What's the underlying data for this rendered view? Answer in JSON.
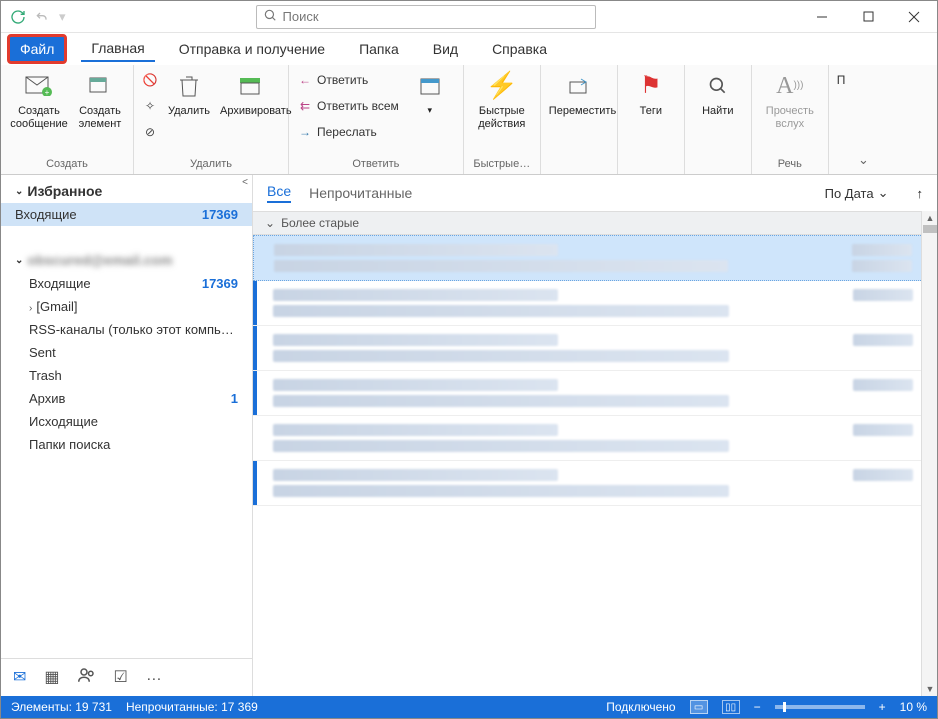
{
  "search": {
    "placeholder": "Поиск"
  },
  "tabs": {
    "file": "Файл",
    "home": "Главная",
    "send": "Отправка и получение",
    "folder": "Папка",
    "view": "Вид",
    "help": "Справка"
  },
  "ribbon": {
    "create": {
      "new_mail": "Создать сообщение",
      "new_item": "Создать элемент",
      "label": "Создать"
    },
    "delete": {
      "delete": "Удалить",
      "archive": "Архивировать",
      "label": "Удалить"
    },
    "respond": {
      "reply": "Ответить",
      "reply_all": "Ответить всем",
      "forward": "Переслать",
      "label": "Ответить"
    },
    "quick": {
      "btn": "Быстрые действия",
      "label": "Быстрые…"
    },
    "move": {
      "btn": "Переместить"
    },
    "tags": {
      "btn": "Теги"
    },
    "find": {
      "btn": "Найти"
    },
    "speech": {
      "btn": "Прочесть вслух",
      "label": "Речь"
    },
    "more": "П"
  },
  "sidebar": {
    "favorites": "Избранное",
    "inbox": "Входящие",
    "inbox_ct": "17369",
    "account": "obscured@email.com",
    "gmail": "[Gmail]",
    "rss": "RSS-каналы (только этот компь…",
    "sent": "Sent",
    "trash": "Trash",
    "archive": "Архив",
    "archive_ct": "1",
    "outbox": "Исходящие",
    "search_folders": "Папки поиска",
    "more": "…"
  },
  "msglist": {
    "all": "Все",
    "unread": "Непрочитанные",
    "sort": "По Дата",
    "group_older": "Более старые"
  },
  "status": {
    "items": "Элементы: 19 731",
    "unread": "Непрочитанные: 17 369",
    "connected": "Подключено",
    "zoom": "10 %"
  }
}
